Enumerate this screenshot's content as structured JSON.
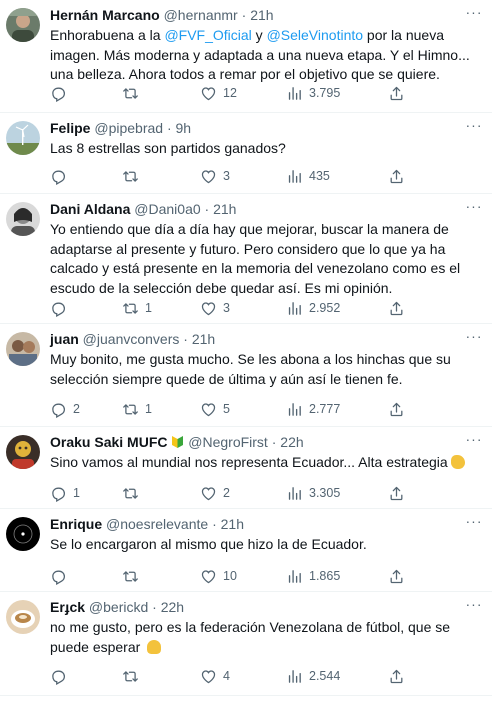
{
  "tweets": [
    {
      "name": "Hernán Marcano",
      "handle": "@hernanmr",
      "dot": "·",
      "time": "21h",
      "text_parts": [
        "Enhorabuena a la ",
        "@FVF_Oficial",
        " y ",
        "@SeleVinotinto",
        " por la nueva imagen. Más moderna y adaptada a una nueva etapa. Y el Himno... una belleza. Ahora todos a remar por el objetivo que se quiere."
      ],
      "replies": "",
      "retweets": "",
      "likes": "12",
      "views": "3.795"
    },
    {
      "name": "Felipe",
      "handle": "@pipebrad",
      "dot": "·",
      "time": "9h",
      "text": "Las 8 estrellas son partidos ganados?",
      "replies": "",
      "retweets": "",
      "likes": "3",
      "views": "435"
    },
    {
      "name": "Dani Aldana",
      "handle": "@Dani0a0",
      "dot": "·",
      "time": "21h",
      "text": "Yo entiendo que día a día hay que mejorar, buscar la manera de adaptarse al presente y futuro. Pero considero que lo que ya ha calcado y está presente en la memoria del venezolano como es el escudo de la selección debe quedar así. Es mi opinión.",
      "replies": "",
      "retweets": "1",
      "likes": "3",
      "views": "2.952"
    },
    {
      "name": "juan",
      "handle": "@juanvconvers",
      "dot": "·",
      "time": "21h",
      "text": "Muy bonito, me gusta mucho. Se les abona a los hinchas que su selección siempre quede de última y aún así le tienen fe.",
      "replies": "2",
      "retweets": "1",
      "likes": "5",
      "views": "2.777"
    },
    {
      "name": "Oraku Saki MUFC",
      "handle": "@NegroFirst",
      "dot": "·",
      "time": "22h",
      "text": "Sino vamos al mundial nos representa Ecuador... Alta estrategia",
      "replies": "1",
      "retweets": "",
      "likes": "2",
      "views": "3.305"
    },
    {
      "name": "Enrique",
      "handle": "@noesrelevante",
      "dot": "·",
      "time": "21h",
      "text": "Se lo encargaron al mismo que hizo la de Ecuador.",
      "replies": "",
      "retweets": "",
      "likes": "10",
      "views": "1.865"
    },
    {
      "name": "Erɟck",
      "handle": "@berickd",
      "dot": "·",
      "time": "22h",
      "text": "no me gusto, pero es la federación Venezolana de fútbol, que se puede esperar",
      "replies": "",
      "retweets": "",
      "likes": "4",
      "views": "2.544"
    }
  ],
  "more_label": "···",
  "icons": {
    "reply": "reply-icon",
    "retweet": "retweet-icon",
    "like": "heart-icon",
    "views": "views-icon",
    "share": "share-icon"
  },
  "colors": {
    "link": "#1d9bf0",
    "secondary": "#536471",
    "text": "#0f1419",
    "divider": "#eff3f4"
  }
}
